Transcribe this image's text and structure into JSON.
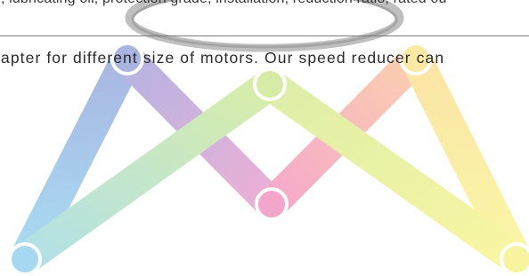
{
  "document": {
    "line_top": "y, lubricating oil, protection grade, installation, reduction ratio, rated ou",
    "line_main": "apter for different size of motors. Our speed reducer can"
  },
  "watermark": {
    "icon_name": "m-logo-watermark-icon",
    "colors": {
      "blue": "#a6d4f0",
      "periwinkle": "#aab5e0",
      "violet": "#caa6dc",
      "pink": "#f3a8cc",
      "peach": "#f9c6b2",
      "lime": "#d9edac",
      "yellow": "#f8f3a0",
      "ring": "#a0a0a0"
    }
  }
}
